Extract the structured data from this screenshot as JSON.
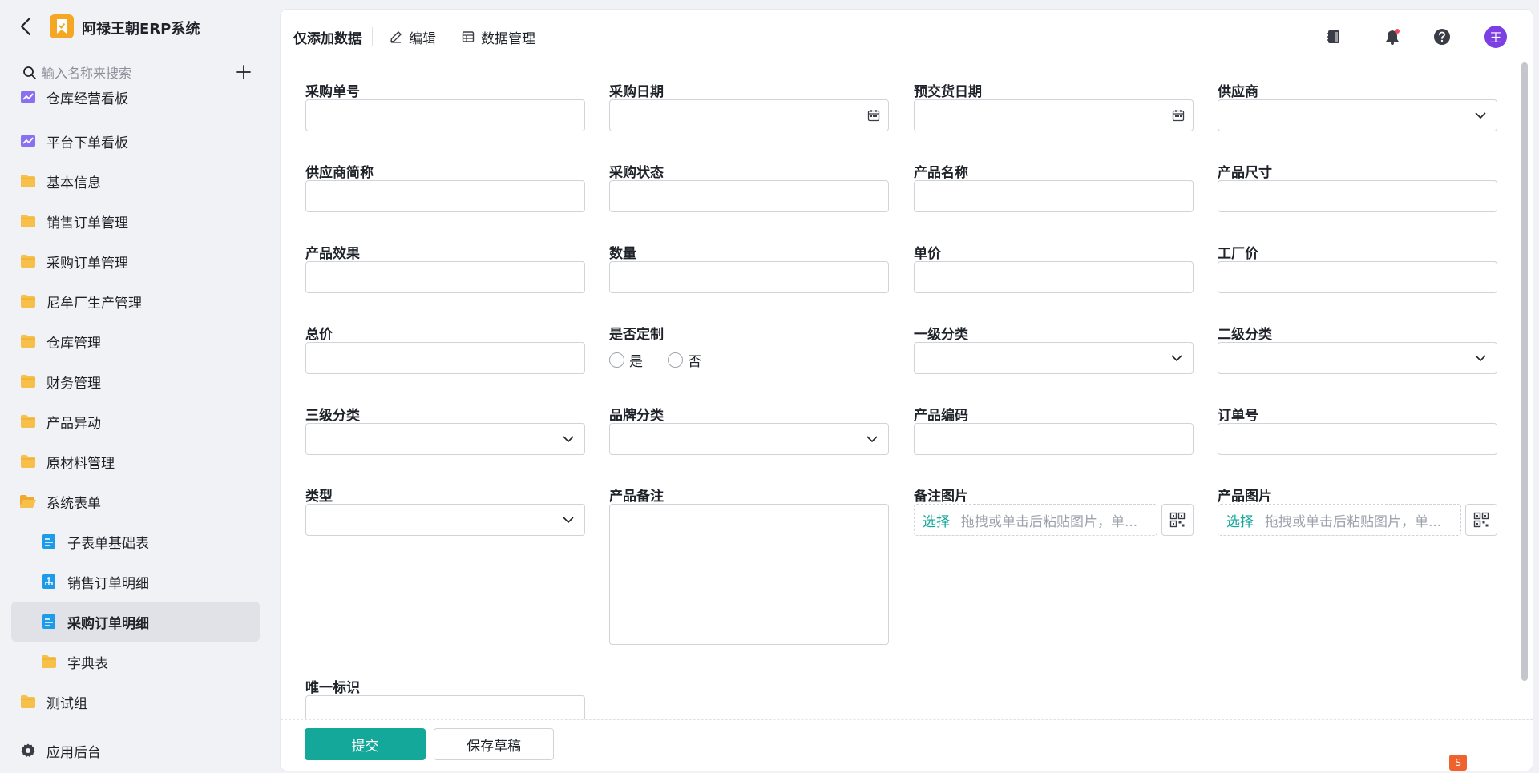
{
  "app": {
    "title": "阿禄王朝ERP系统"
  },
  "sidebar": {
    "search_placeholder": "输入名称来搜索",
    "items": [
      {
        "label": "仓库经营看板",
        "icon": "dashboard-icon"
      },
      {
        "label": "平台下单看板",
        "icon": "dashboard-icon"
      },
      {
        "label": "基本信息",
        "icon": "folder-icon"
      },
      {
        "label": "销售订单管理",
        "icon": "folder-icon"
      },
      {
        "label": "采购订单管理",
        "icon": "folder-icon"
      },
      {
        "label": "尼牟厂生产管理",
        "icon": "folder-icon"
      },
      {
        "label": "仓库管理",
        "icon": "folder-icon"
      },
      {
        "label": "财务管理",
        "icon": "folder-icon"
      },
      {
        "label": "产品异动",
        "icon": "folder-icon"
      },
      {
        "label": "原材料管理",
        "icon": "folder-icon"
      },
      {
        "label": "系统表单",
        "icon": "folder-open-icon"
      },
      {
        "label": "子表单基础表",
        "icon": "form-icon"
      },
      {
        "label": "销售订单明细",
        "icon": "flow-icon"
      },
      {
        "label": "采购订单明细",
        "icon": "form-icon"
      },
      {
        "label": "字典表",
        "icon": "folder-icon"
      },
      {
        "label": "测试组",
        "icon": "folder-icon"
      }
    ],
    "footer_label": "应用后台"
  },
  "topbar": {
    "title": "仅添加数据",
    "edit_label": "编辑",
    "data_manage_label": "数据管理",
    "avatar_text": "王"
  },
  "form": {
    "purchase_no": "采购单号",
    "purchase_date": "采购日期",
    "delivery_date": "预交货日期",
    "supplier": "供应商",
    "supplier_short": "供应商简称",
    "purchase_status": "采购状态",
    "product_name": "产品名称",
    "product_size": "产品尺寸",
    "product_effect": "产品效果",
    "quantity": "数量",
    "unit_price": "单价",
    "factory_price": "工厂价",
    "total_price": "总价",
    "customized": "是否定制",
    "yes": "是",
    "no": "否",
    "cat1": "一级分类",
    "cat2": "二级分类",
    "cat3": "三级分类",
    "brand_cat": "品牌分类",
    "product_code": "产品编码",
    "order_no": "订单号",
    "type": "类型",
    "product_note": "产品备注",
    "note_image": "备注图片",
    "product_image": "产品图片",
    "upload_select": "选择",
    "upload_hint": "拖拽或单击后粘贴图片，单...",
    "unique_id": "唯一标识"
  },
  "footer": {
    "submit_label": "提交",
    "draft_label": "保存草稿"
  },
  "colors": {
    "accent": "#13a89a",
    "avatar": "#7b3fe4",
    "logo": "#f5a623",
    "folder": "#f7c04a"
  }
}
